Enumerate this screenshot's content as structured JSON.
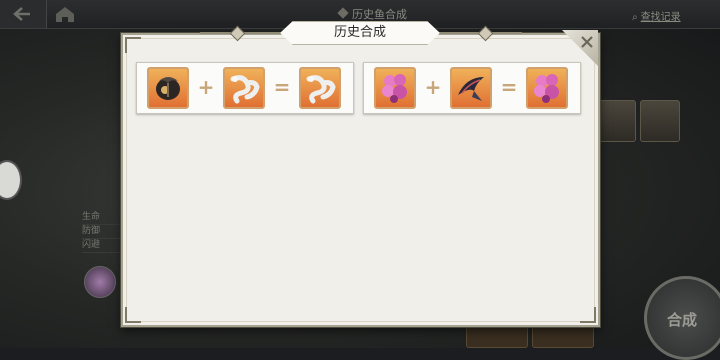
{
  "topbar": {
    "title": "历史鱼合成",
    "search_record": "查找记录"
  },
  "stats": [
    "生命",
    "防御",
    "闪避"
  ],
  "popup": {
    "title": "历史合成",
    "plus": "+",
    "equals": "="
  },
  "recipes": [
    {
      "a": "dark-masked-fish-icon",
      "b": "white-serpent-fish-icon",
      "result": "white-serpent-fish-icon"
    },
    {
      "a": "pink-curly-fish-icon",
      "b": "dark-swallow-fish-icon",
      "result": "pink-curly-fish-icon"
    }
  ],
  "fuse_button": "合成",
  "colors": {
    "tile_bg": "#e07033",
    "panel_bg": "#f1efea",
    "tile_border": "#d2a16b"
  }
}
